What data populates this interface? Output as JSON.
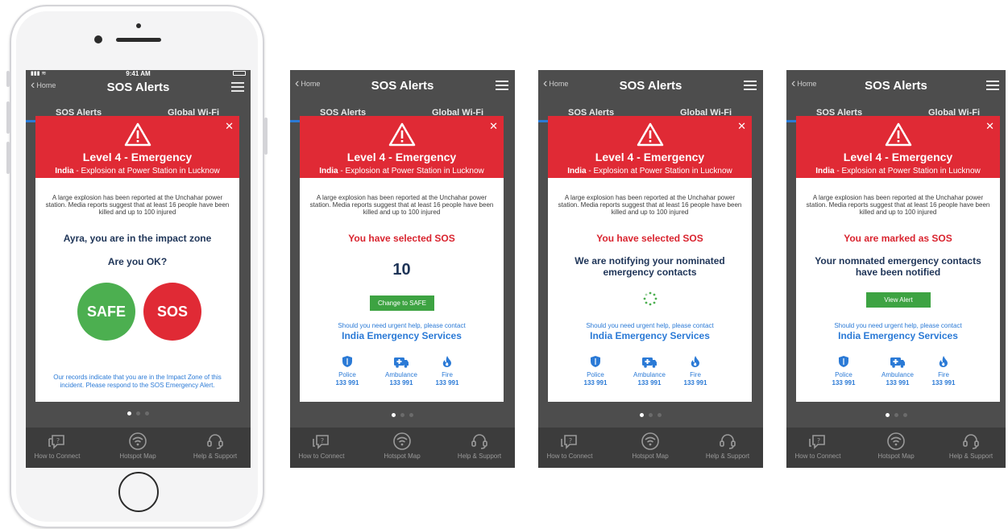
{
  "phone_status": {
    "time": "9:41 AM"
  },
  "nav": {
    "back_label": "Home",
    "title": "SOS Alerts"
  },
  "tabs": {
    "left": "SOS Alerts",
    "right": "Global Wi-Fi"
  },
  "alert": {
    "level": "Level 4 - Emergency",
    "country": "India",
    "subtitle_rest": " - Explosion at Power Station in Lucknow",
    "description": "A large explosion has been reported at the Unchahar power station. Media reports suggest that at least 16 people have been killed and up to 100 injured"
  },
  "screen1": {
    "impact_text": "Ayra, you are in the impact zone",
    "question": "Are you OK?",
    "safe_label": "SAFE",
    "sos_label": "SOS",
    "footer": "Our records indicate that you are in the Impact Zone of this incident. Please respond to the SOS Emergency Alert."
  },
  "screen2": {
    "selected_text": "You have selected SOS",
    "countdown": "10",
    "change_button": "Change to SAFE"
  },
  "screen3": {
    "selected_text": "You have selected SOS",
    "notify_line1": "We are notifying your nominated",
    "notify_line2": "emergency contacts"
  },
  "screen4": {
    "marked_text": "You are marked as SOS",
    "notified_line1": "Your nomnated emergency contacts",
    "notified_line2": "have been notified",
    "view_button": "View Alert"
  },
  "help": {
    "urgent_text": "Should you need urgent help, please contact",
    "services_title": "India Emergency Services",
    "police": {
      "name": "Police",
      "number": "133 991"
    },
    "ambulance": {
      "name": "Ambulance",
      "number": "133 991"
    },
    "fire": {
      "name": "Fire",
      "number": "133 991"
    }
  },
  "tabbar": {
    "how_to_connect": "How to Connect",
    "hotspot_map": "Hotspot Map",
    "help_support": "Help & Support"
  },
  "colors": {
    "alert_red": "#e02a35",
    "safe_green": "#4caf50",
    "link_blue": "#2b7ad6",
    "navy": "#1f3558"
  },
  "icons": [
    "warning-icon",
    "close-icon",
    "shield-icon",
    "ambulance-icon",
    "flame-icon",
    "chat-question-icon",
    "wifi-icon",
    "headset-icon",
    "menu-icon",
    "chevron-left-icon",
    "spinner-icon"
  ]
}
